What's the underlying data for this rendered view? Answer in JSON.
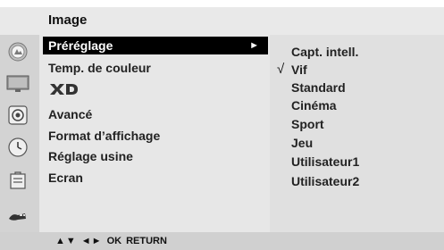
{
  "header": {
    "title": "Image"
  },
  "sidebar": {
    "icons": [
      "picture-icon",
      "tv-icon",
      "speaker-icon",
      "clock-icon",
      "lock-icon",
      "input-icon"
    ]
  },
  "menu": {
    "items": [
      {
        "label": "Préréglage",
        "selected": true,
        "has_submenu": true,
        "arrow": "►"
      },
      {
        "label": "Temp. de couleur"
      },
      {
        "label": "XD",
        "logo": true
      },
      {
        "label": "Avancé"
      },
      {
        "label": "Format d’affichage"
      },
      {
        "label": "Réglage usine"
      },
      {
        "label": "Ecran"
      }
    ]
  },
  "submenu": {
    "check": "√",
    "checked_index": 1,
    "items": [
      {
        "label": "Capt. intell."
      },
      {
        "label": "Vif"
      },
      {
        "label": "Standard"
      },
      {
        "label": "Cinéma"
      },
      {
        "label": "Sport"
      },
      {
        "label": "Jeu"
      },
      {
        "label": "Utilisateur1"
      },
      {
        "label": "Utilisateur2"
      }
    ]
  },
  "footer": {
    "nav_up_down": "▲▼",
    "nav_left_right": "◄►",
    "ok": "OK",
    "return": "RETURN"
  }
}
